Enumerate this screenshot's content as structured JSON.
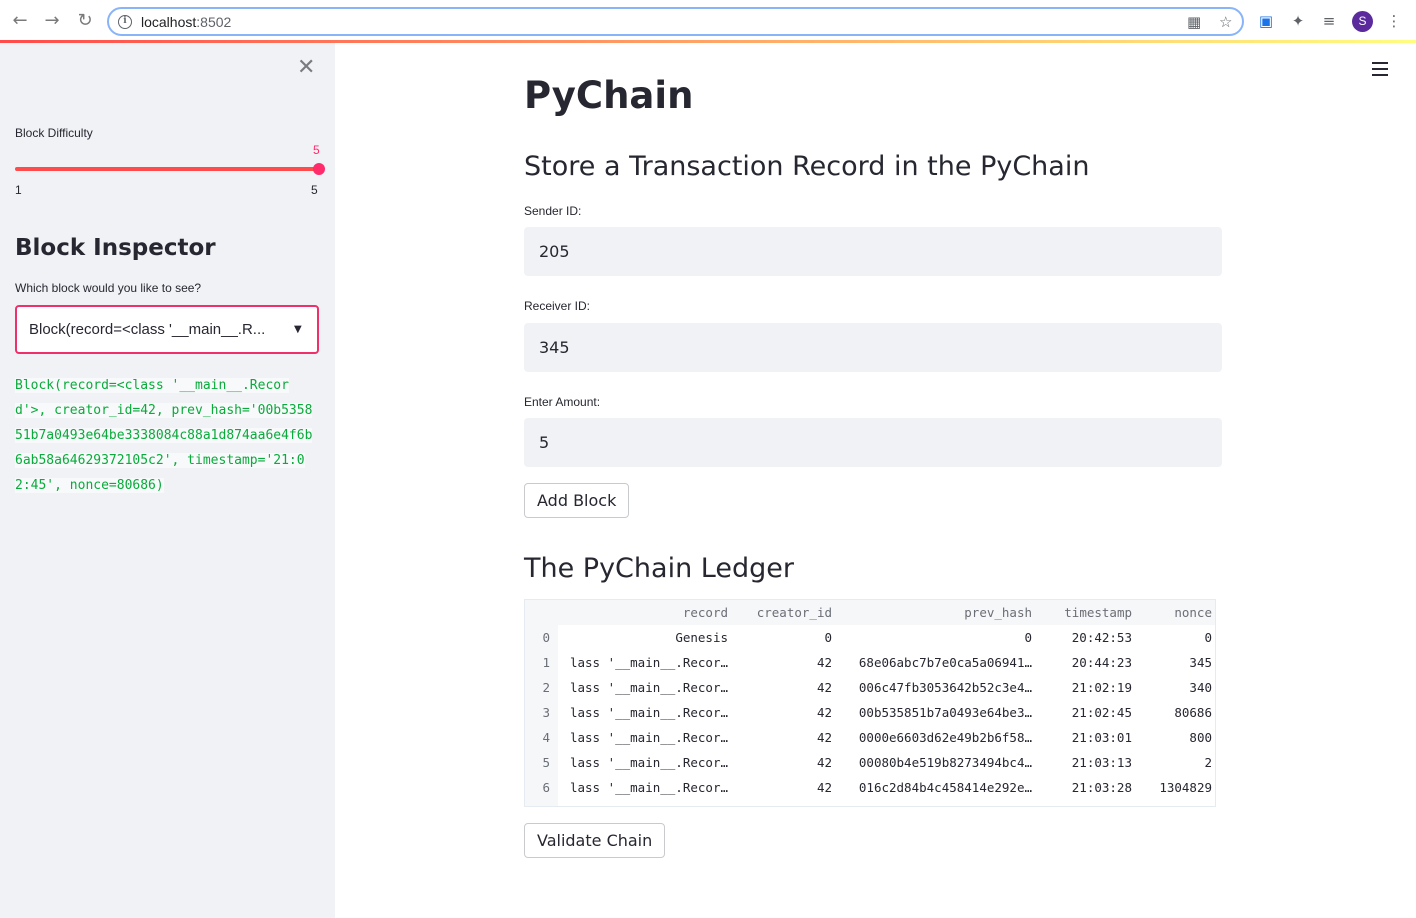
{
  "browser": {
    "url_host": "localhost",
    "url_port": ":8502",
    "avatar_letter": "S"
  },
  "sidebar": {
    "slider": {
      "label": "Block Difficulty",
      "value": 5,
      "value_text": "5",
      "min": "1",
      "max": "5"
    },
    "title": "Block Inspector",
    "select": {
      "label": "Which block would you like to see?",
      "selected": "Block(record=<class '__main__.R..."
    },
    "output": "Block(record=<class '__main__.Record'>, creator_id=42, prev_hash='00b535851b7a0493e64be3338084c88a1d874aa6e4f6b6ab58a64629372105c2', timestamp='21:02:45', nonce=80686)"
  },
  "main": {
    "title": "PyChain",
    "store_heading": "Store a Transaction Record in the PyChain",
    "sender_label": "Sender ID:",
    "sender_value": "205",
    "receiver_label": "Receiver ID:",
    "receiver_value": "345",
    "amount_label": "Enter Amount:",
    "amount_value": "5",
    "add_button": "Add Block",
    "ledger_heading": "The PyChain Ledger",
    "validate_button": "Validate Chain"
  },
  "ledger": {
    "columns": [
      "record",
      "creator_id",
      "prev_hash",
      "timestamp",
      "nonce"
    ],
    "rows": [
      [
        "0",
        "Genesis",
        "0",
        "0",
        "20:42:53",
        "0"
      ],
      [
        "1",
        "lass '__main__.Recor…",
        "42",
        "68e06abc7b7e0ca5a06941…",
        "20:44:23",
        "345"
      ],
      [
        "2",
        "lass '__main__.Recor…",
        "42",
        "006c47fb3053642b52c3e4…",
        "21:02:19",
        "340"
      ],
      [
        "3",
        "lass '__main__.Recor…",
        "42",
        "00b535851b7a0493e64be3…",
        "21:02:45",
        "80686"
      ],
      [
        "4",
        "lass '__main__.Recor…",
        "42",
        "0000e6603d62e49b2b6f58…",
        "21:03:01",
        "800"
      ],
      [
        "5",
        "lass '__main__.Recor…",
        "42",
        "00080b4e519b8273494bc4…",
        "21:03:13",
        "2"
      ],
      [
        "6",
        "lass '__main__.Recor…",
        "42",
        "016c2d84b4c458414e292e…",
        "21:03:28",
        "1304829"
      ]
    ]
  },
  "colors": {
    "accent": "#ff4b4b",
    "slider_value": "#ff2b6b",
    "code_text": "#09ab3b",
    "sidebar_bg": "#f0f2f6"
  }
}
